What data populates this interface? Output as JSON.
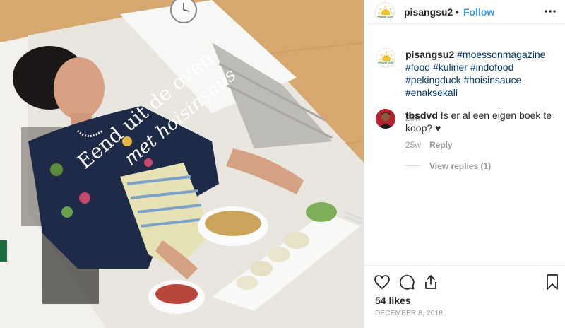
{
  "header": {
    "username": "pisangsu2",
    "separator": "•",
    "follow_label": "Follow",
    "more_icon": "more-horizontal-icon"
  },
  "logo": {
    "text": "PISANG SUSU"
  },
  "caption": {
    "username": "pisangsu2",
    "hashtags": [
      "#moessonmagazine",
      "#food",
      "#kuliner",
      "#indofood",
      "#pekingduck",
      "#hoisinsauce",
      "#enaksekali"
    ],
    "time": "25w"
  },
  "comment": {
    "username": "tbsdvd",
    "text": "Is er al een eigen boek te koop? ♥",
    "time": "25w",
    "reply_label": "Reply",
    "view_replies": "View replies (1)"
  },
  "actions": {
    "like_icon": "heart-icon",
    "comment_icon": "comment-icon",
    "share_icon": "share-icon",
    "save_icon": "bookmark-icon",
    "likes": "54 likes",
    "date": "DECEMBER 8, 2018"
  },
  "photo": {
    "title_line1": "Eend uit de oven",
    "title_line2": "met hoisinsaus"
  },
  "colors": {
    "accent": "#3897f0",
    "hashtag": "#003569",
    "muted": "#999999"
  }
}
